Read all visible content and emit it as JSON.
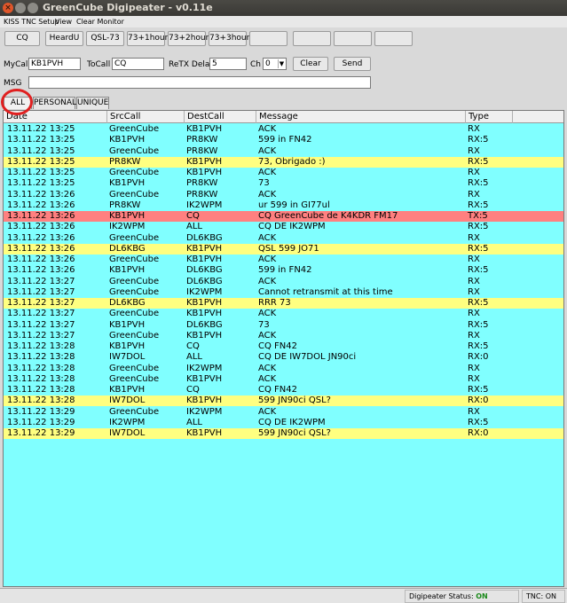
{
  "window": {
    "title": "GreenCube Digipeater - v0.11e"
  },
  "menu": {
    "items": [
      "KISS TNC Setup",
      "View",
      "Clear Monitor"
    ]
  },
  "toolbar": {
    "buttons": [
      "CQ",
      "HeardU",
      "QSL-73",
      "73+1hour",
      "73+2hour",
      "73+3hour",
      "",
      "",
      "",
      ""
    ]
  },
  "form": {
    "mycall_label": "MyCall",
    "mycall_value": "KB1PVH",
    "tocall_label": "ToCall",
    "tocall_value": "CQ",
    "retx_label": "ReTX Delay",
    "retx_value": "5",
    "ch_label": "Ch",
    "ch_value": "0",
    "clear_label": "Clear",
    "send_label": "Send",
    "msg_label": "MSG",
    "msg_value": ""
  },
  "tabs": [
    "ALL",
    "PERSONAL",
    "UNIQUE"
  ],
  "table": {
    "columns": [
      "Date",
      "SrcCall",
      "DestCall",
      "Message",
      "Type"
    ],
    "rows": [
      {
        "date": "13.11.22 13:25",
        "src": "GreenCube",
        "dest": "KB1PVH",
        "msg": "ACK",
        "type": "RX",
        "hl": ""
      },
      {
        "date": "13.11.22 13:25",
        "src": "KB1PVH",
        "dest": "PR8KW",
        "msg": "599 in FN42",
        "type": "RX:5",
        "hl": ""
      },
      {
        "date": "13.11.22 13:25",
        "src": "GreenCube",
        "dest": "PR8KW",
        "msg": "ACK",
        "type": "RX",
        "hl": ""
      },
      {
        "date": "13.11.22 13:25",
        "src": "PR8KW",
        "dest": "KB1PVH",
        "msg": "73, Obrigado :)",
        "type": "RX:5",
        "hl": "yellow"
      },
      {
        "date": "13.11.22 13:25",
        "src": "GreenCube",
        "dest": "KB1PVH",
        "msg": "ACK",
        "type": "RX",
        "hl": ""
      },
      {
        "date": "13.11.22 13:25",
        "src": "KB1PVH",
        "dest": "PR8KW",
        "msg": "73",
        "type": "RX:5",
        "hl": ""
      },
      {
        "date": "13.11.22 13:26",
        "src": "GreenCube",
        "dest": "PR8KW",
        "msg": "ACK",
        "type": "RX",
        "hl": ""
      },
      {
        "date": "13.11.22 13:26",
        "src": "PR8KW",
        "dest": "IK2WPM",
        "msg": "ur 599 in GI77ul",
        "type": "RX:5",
        "hl": ""
      },
      {
        "date": "13.11.22 13:26",
        "src": "KB1PVH",
        "dest": "CQ",
        "msg": "CQ GreenCube de K4KDR FM17",
        "type": "TX:5",
        "hl": "red"
      },
      {
        "date": "13.11.22 13:26",
        "src": "IK2WPM",
        "dest": "ALL",
        "msg": "CQ DE IK2WPM",
        "type": "RX:5",
        "hl": ""
      },
      {
        "date": "13.11.22 13:26",
        "src": "GreenCube",
        "dest": "DL6KBG",
        "msg": "ACK",
        "type": "RX",
        "hl": ""
      },
      {
        "date": "13.11.22 13:26",
        "src": "DL6KBG",
        "dest": "KB1PVH",
        "msg": "QSL 599 JO71",
        "type": "RX:5",
        "hl": "yellow"
      },
      {
        "date": "13.11.22 13:26",
        "src": "GreenCube",
        "dest": "KB1PVH",
        "msg": "ACK",
        "type": "RX",
        "hl": ""
      },
      {
        "date": "13.11.22 13:26",
        "src": "KB1PVH",
        "dest": "DL6KBG",
        "msg": "599 in FN42",
        "type": "RX:5",
        "hl": ""
      },
      {
        "date": "13.11.22 13:27",
        "src": "GreenCube",
        "dest": "DL6KBG",
        "msg": "ACK",
        "type": "RX",
        "hl": ""
      },
      {
        "date": "13.11.22 13:27",
        "src": "GreenCube",
        "dest": "IK2WPM",
        "msg": "Cannot retransmit at this time",
        "type": "RX",
        "hl": ""
      },
      {
        "date": "13.11.22 13:27",
        "src": "DL6KBG",
        "dest": "KB1PVH",
        "msg": "RRR 73",
        "type": "RX:5",
        "hl": "yellow"
      },
      {
        "date": "13.11.22 13:27",
        "src": "GreenCube",
        "dest": "KB1PVH",
        "msg": "ACK",
        "type": "RX",
        "hl": ""
      },
      {
        "date": "13.11.22 13:27",
        "src": "KB1PVH",
        "dest": "DL6KBG",
        "msg": "73",
        "type": "RX:5",
        "hl": ""
      },
      {
        "date": "13.11.22 13:27",
        "src": "GreenCube",
        "dest": "KB1PVH",
        "msg": "ACK",
        "type": "RX",
        "hl": ""
      },
      {
        "date": "13.11.22 13:28",
        "src": "KB1PVH",
        "dest": "CQ",
        "msg": "CQ FN42",
        "type": "RX:5",
        "hl": ""
      },
      {
        "date": "13.11.22 13:28",
        "src": "IW7DOL",
        "dest": "ALL",
        "msg": "CQ DE IW7DOL  JN90ci",
        "type": "RX:0",
        "hl": ""
      },
      {
        "date": "13.11.22 13:28",
        "src": "GreenCube",
        "dest": "IK2WPM",
        "msg": "ACK",
        "type": "RX",
        "hl": ""
      },
      {
        "date": "13.11.22 13:28",
        "src": "GreenCube",
        "dest": "KB1PVH",
        "msg": "ACK",
        "type": "RX",
        "hl": ""
      },
      {
        "date": "13.11.22 13:28",
        "src": "KB1PVH",
        "dest": "CQ",
        "msg": "CQ FN42",
        "type": "RX:5",
        "hl": ""
      },
      {
        "date": "13.11.22 13:28",
        "src": "IW7DOL",
        "dest": "KB1PVH",
        "msg": "599 JN90ci QSL?",
        "type": "RX:0",
        "hl": "yellow"
      },
      {
        "date": "13.11.22 13:29",
        "src": "GreenCube",
        "dest": "IK2WPM",
        "msg": "ACK",
        "type": "RX",
        "hl": ""
      },
      {
        "date": "13.11.22 13:29",
        "src": "IK2WPM",
        "dest": "ALL",
        "msg": "CQ DE IK2WPM",
        "type": "RX:5",
        "hl": ""
      },
      {
        "date": "13.11.22 13:29",
        "src": "IW7DOL",
        "dest": "KB1PVH",
        "msg": "599 JN90ci QSL?",
        "type": "RX:0",
        "hl": "yellow"
      }
    ]
  },
  "status": {
    "digipeater_label": "Digipeater Status:",
    "digipeater_value": "ON",
    "tnc_label": "TNC:",
    "tnc_value": "ON"
  },
  "colors": {
    "table_bg": "#80ffff",
    "highlight_yellow": "#ffff80",
    "highlight_red": "#ff8080",
    "status_on": "#1a8a1a",
    "annotation_ring": "#e02020"
  }
}
